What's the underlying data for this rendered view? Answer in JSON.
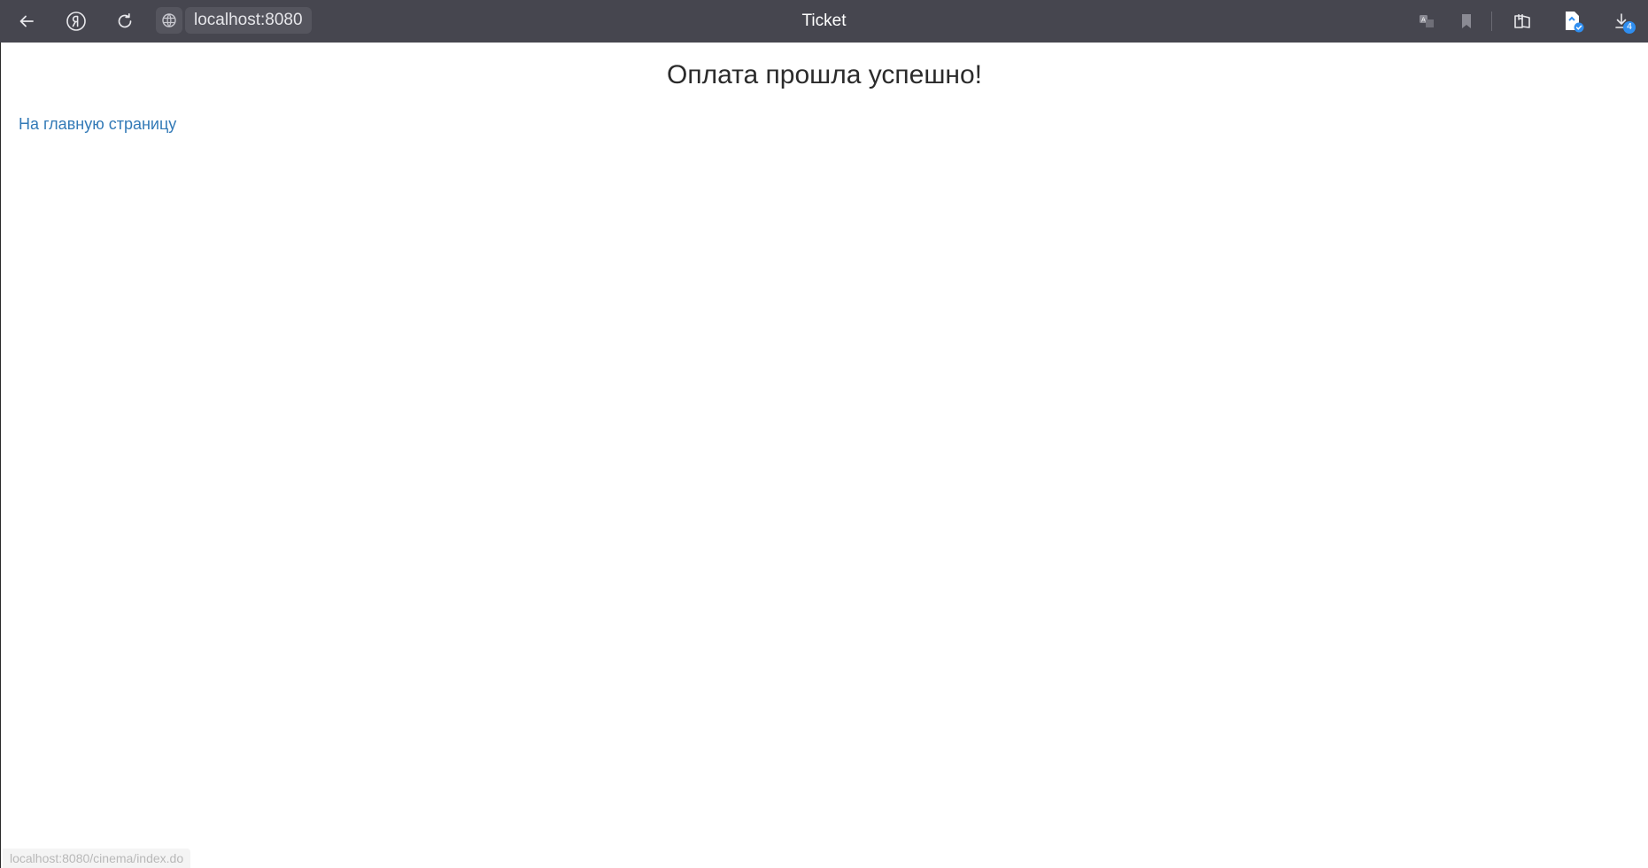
{
  "browser": {
    "url": "localhost:8080",
    "tab_title": "Ticket",
    "downloads_count": "4",
    "accent_color": "#2f8ef0",
    "toolbar_color": "#46464f"
  },
  "icons": {
    "back": "arrow-left-icon",
    "yandex": "yandex-logo-icon",
    "reload": "reload-icon",
    "site_info": "globe-icon",
    "translate": "translate-icon",
    "bookmark": "bookmark-icon",
    "collections": "collections-icon",
    "extension": "document-check-icon",
    "downloads": "download-icon"
  },
  "page": {
    "heading": "Оплата прошла успешно!",
    "home_link": "На главную страницу",
    "link_color": "#337ab7"
  },
  "status_bar": {
    "hover_url": "localhost:8080/cinema/index.do"
  }
}
